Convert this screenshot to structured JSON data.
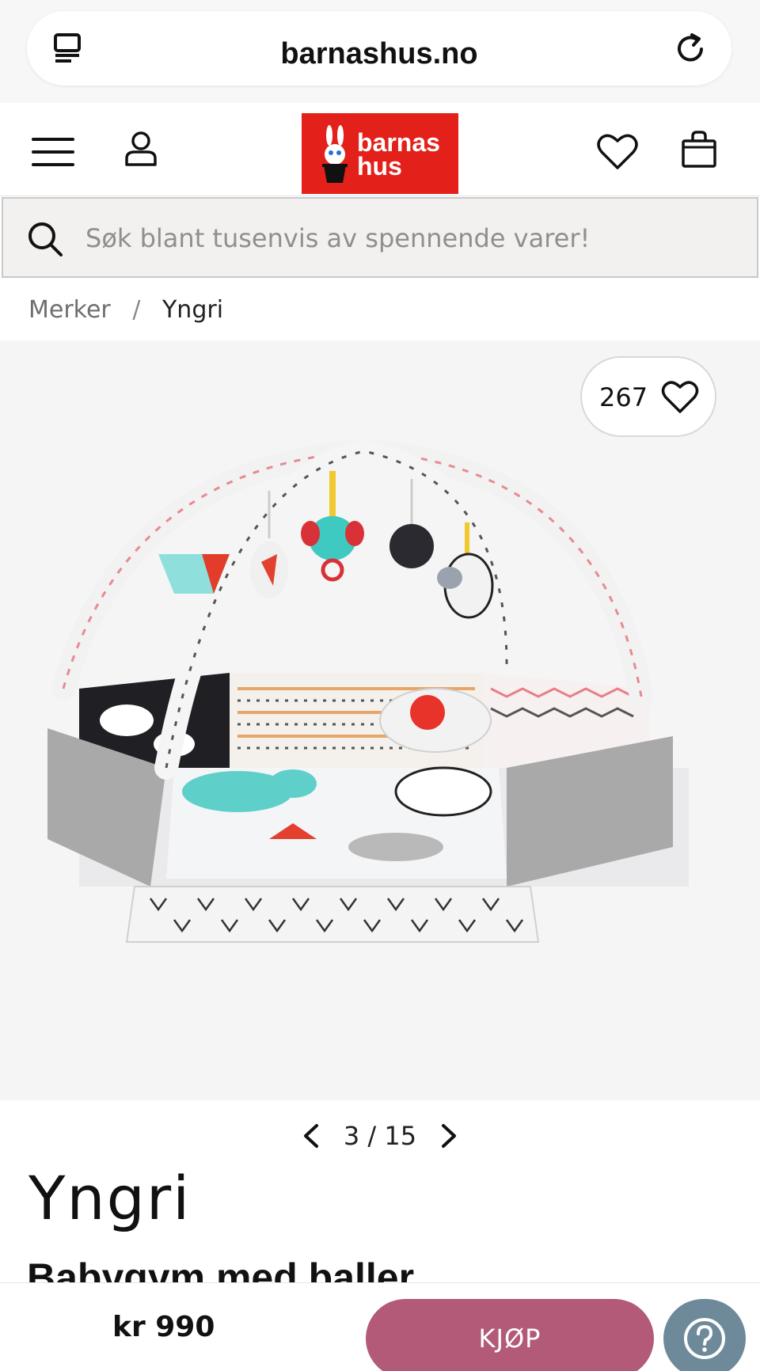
{
  "browser": {
    "url": "barnashus.no",
    "tabs_icon": "tabs-icon",
    "reload_icon": "reload-icon"
  },
  "header": {
    "menu_icon": "menu-icon",
    "account_icon": "user-icon",
    "logo_line1": "barnas",
    "logo_line2": "hus",
    "wishlist_icon": "heart-icon",
    "cart_icon": "bag-icon",
    "logo_color": "#e3211a"
  },
  "search": {
    "placeholder": "Søk blant tusenvis av spennende varer!",
    "icon": "search-icon"
  },
  "breadcrumb": {
    "items": [
      "Merker",
      "Yngri"
    ],
    "separator": "/"
  },
  "gallery": {
    "likes": "267",
    "current": "3",
    "total": "15",
    "separator": "/"
  },
  "product": {
    "brand": "Yngri",
    "title": "Babygym med baller",
    "price": "kr 990"
  },
  "actions": {
    "buy_label": "KJØP",
    "buy_color": "#b25a78",
    "help_color": "#6e8a9a"
  }
}
